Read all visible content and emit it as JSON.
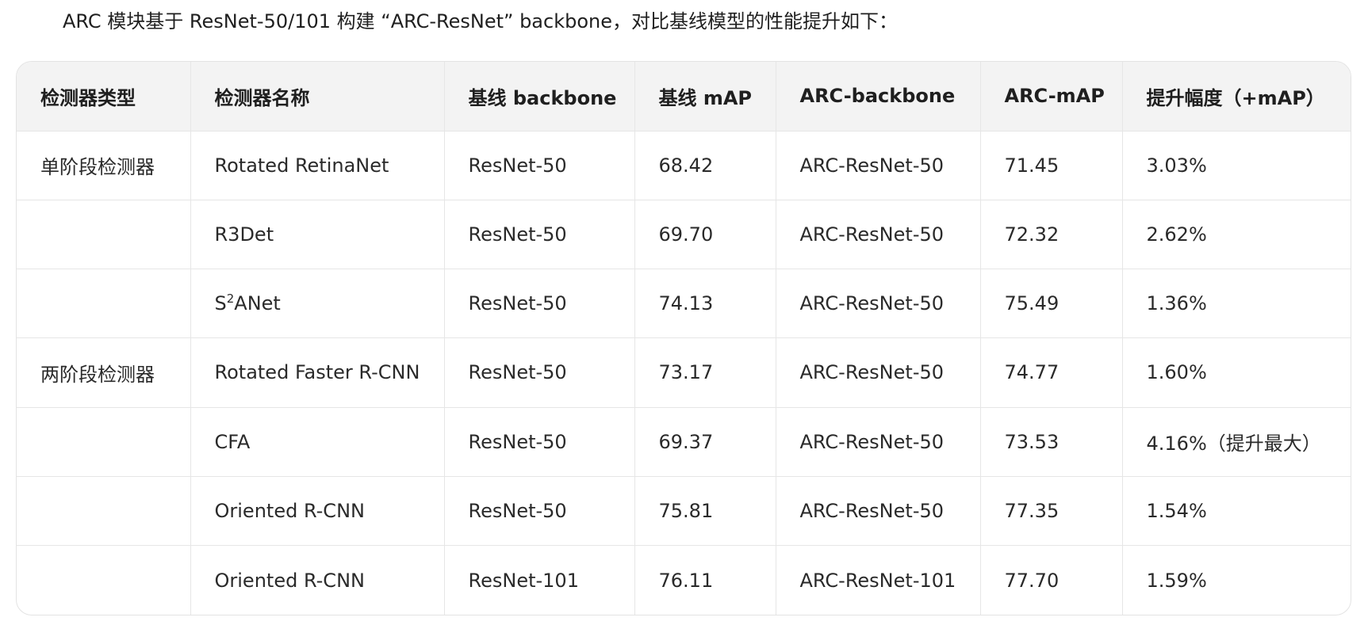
{
  "intro_text": "ARC 模块基于 ResNet-50/101 构建 “ARC-ResNet” backbone，对比基线模型的性能提升如下：",
  "table": {
    "headers": [
      "检测器类型",
      "检测器名称",
      "基线 backbone",
      "基线 mAP",
      "ARC-backbone",
      "ARC-mAP",
      "提升幅度（+mAP）"
    ],
    "rows": [
      {
        "type": "单阶段检测器",
        "name": "Rotated RetinaNet",
        "base_backbone": "ResNet-50",
        "base_map": "68.42",
        "arc_backbone": "ARC-ResNet-50",
        "arc_map": "71.45",
        "gain": "3.03%"
      },
      {
        "type": "",
        "name": "R3Det",
        "base_backbone": "ResNet-50",
        "base_map": "69.70",
        "arc_backbone": "ARC-ResNet-50",
        "arc_map": "72.32",
        "gain": "2.62%"
      },
      {
        "type": "",
        "name_prefix": "S",
        "name_sup": "2",
        "name_suffix": "ANet",
        "base_backbone": "ResNet-50",
        "base_map": "74.13",
        "arc_backbone": "ARC-ResNet-50",
        "arc_map": "75.49",
        "gain": "1.36%"
      },
      {
        "type": "两阶段检测器",
        "name": "Rotated Faster R-CNN",
        "base_backbone": "ResNet-50",
        "base_map": "73.17",
        "arc_backbone": "ARC-ResNet-50",
        "arc_map": "74.77",
        "gain": "1.60%"
      },
      {
        "type": "",
        "name": "CFA",
        "base_backbone": "ResNet-50",
        "base_map": "69.37",
        "arc_backbone": "ARC-ResNet-50",
        "arc_map": "73.53",
        "gain": "4.16%（提升最大）"
      },
      {
        "type": "",
        "name": "Oriented R-CNN",
        "base_backbone": "ResNet-50",
        "base_map": "75.81",
        "arc_backbone": "ARC-ResNet-50",
        "arc_map": "77.35",
        "gain": "1.54%"
      },
      {
        "type": "",
        "name": "Oriented R-CNN",
        "base_backbone": "ResNet-101",
        "base_map": "76.11",
        "arc_backbone": "ARC-ResNet-101",
        "arc_map": "77.70",
        "gain": "1.59%"
      }
    ]
  }
}
